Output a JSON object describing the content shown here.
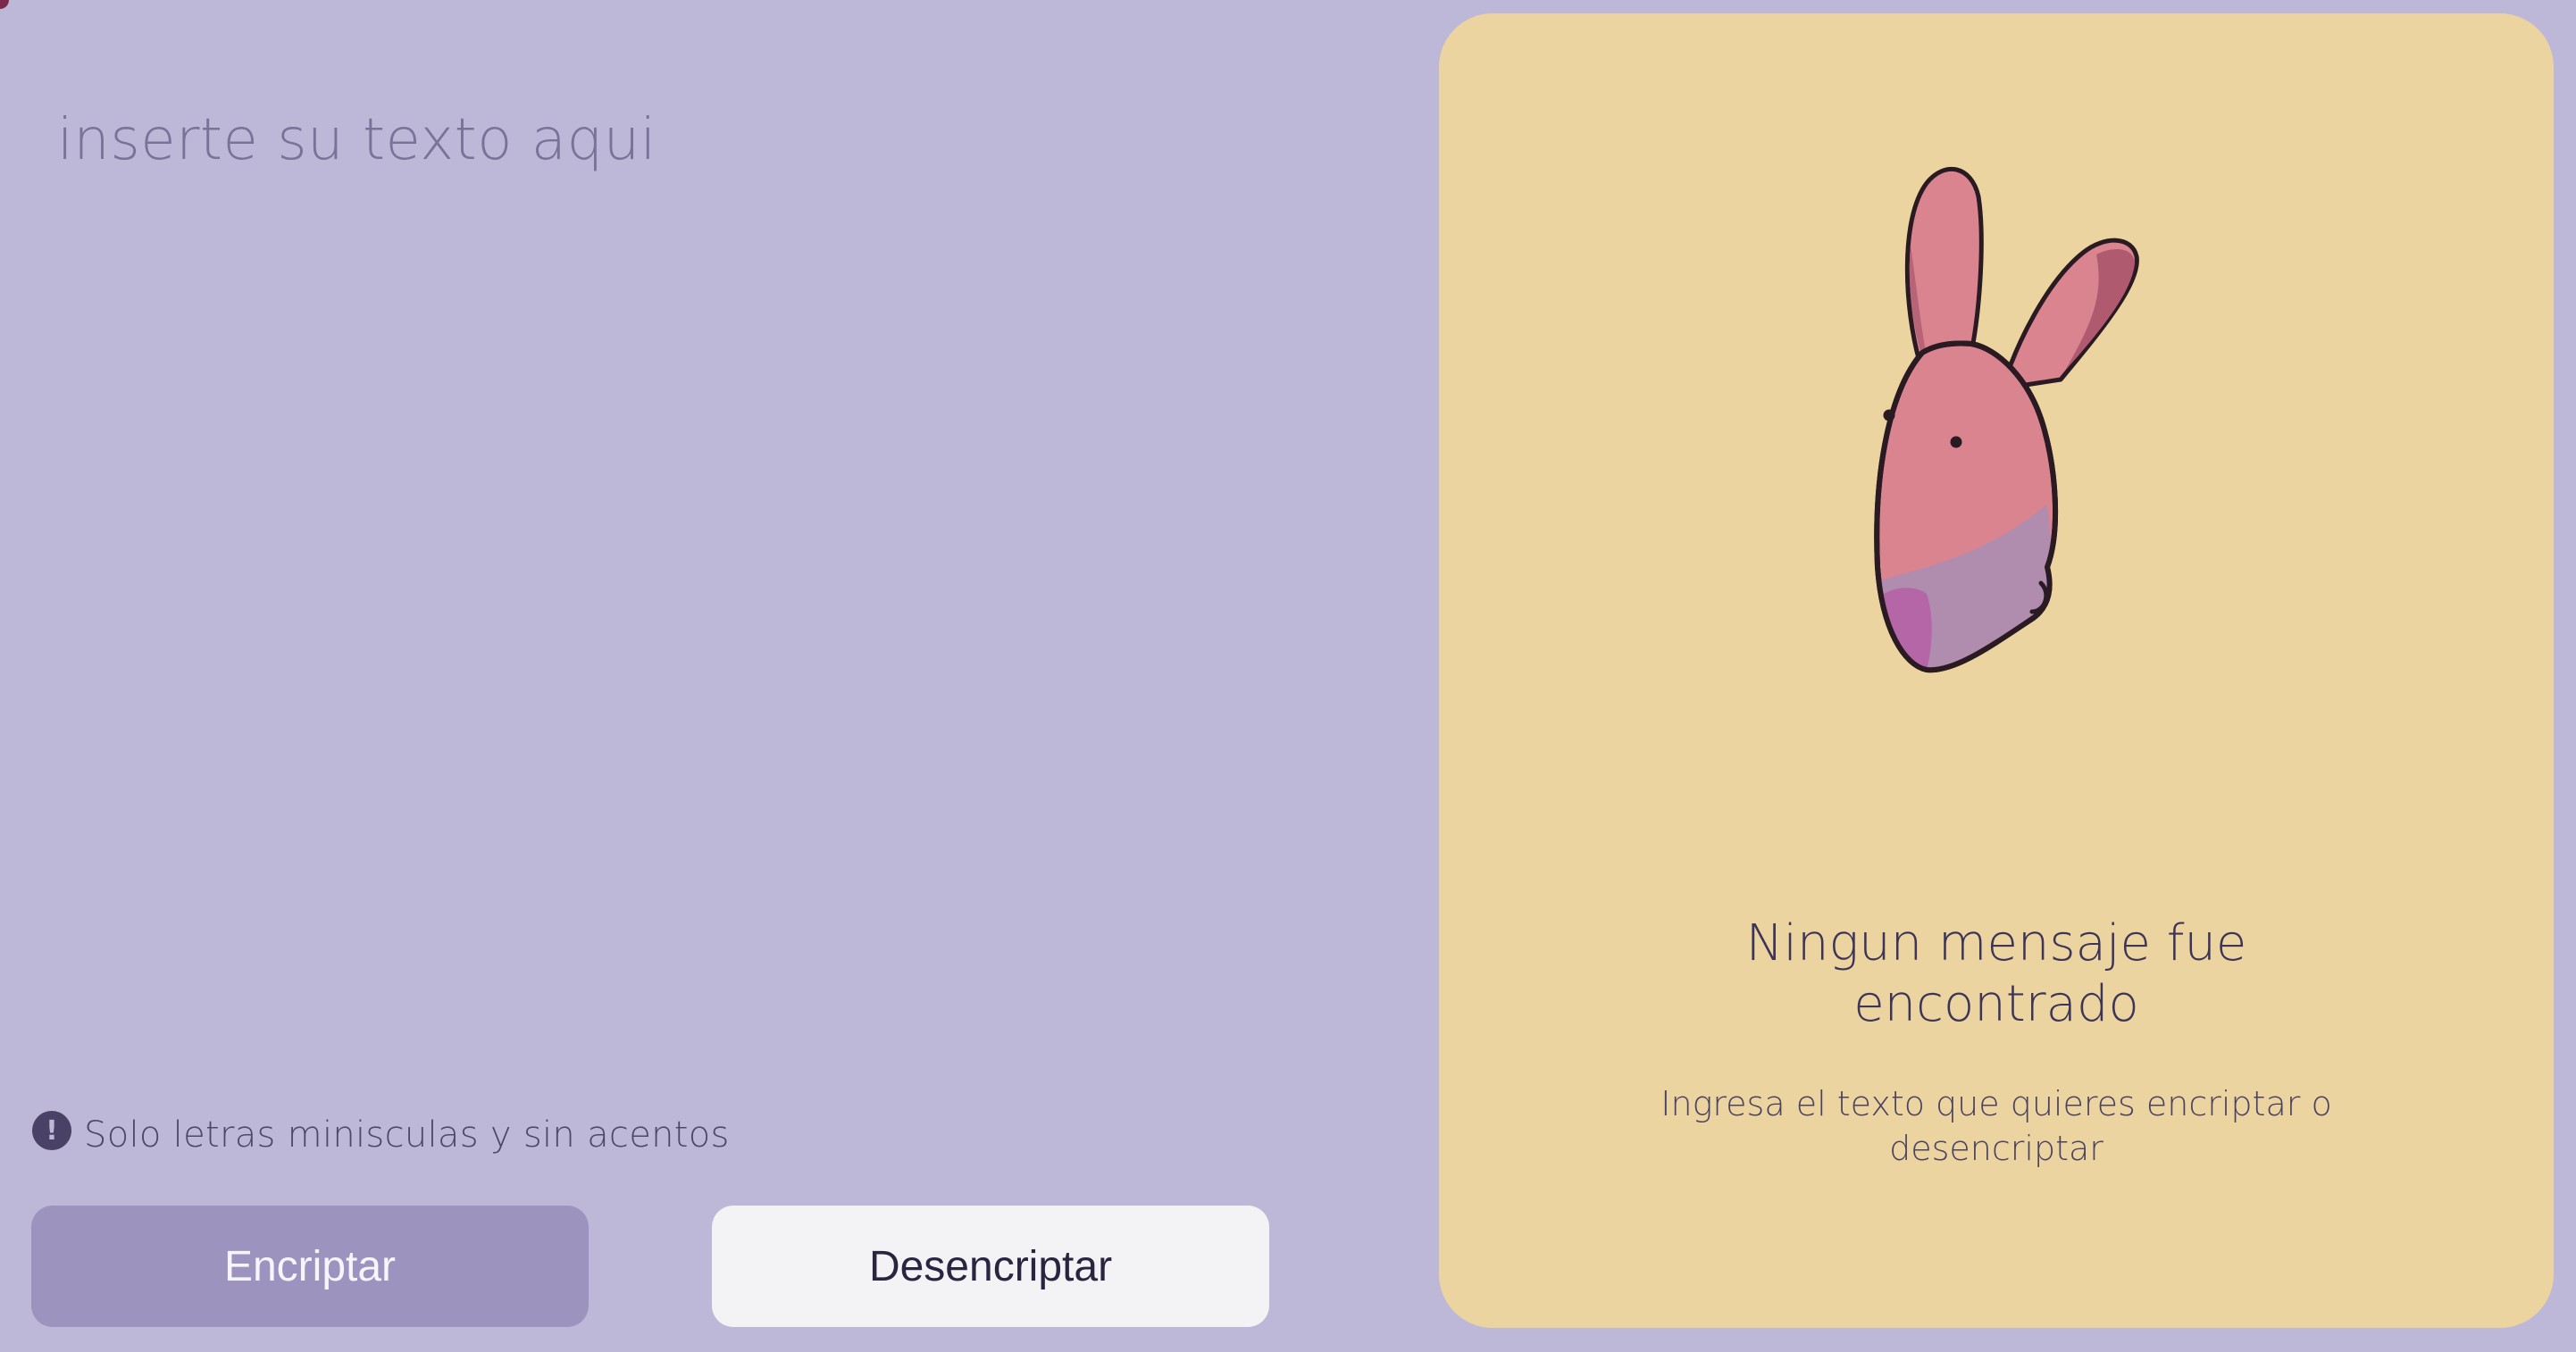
{
  "input": {
    "placeholder": "inserte su texto aqui"
  },
  "hint": {
    "icon": "exclamation-circle-icon",
    "text": "Solo letras miniscu​las y sin acentos"
  },
  "buttons": {
    "encrypt_label": "Encriptar",
    "decrypt_label": "Desencriptar"
  },
  "result_card": {
    "illustration": "bunny-illustration",
    "title_line1": "Ningun mensaje fue",
    "title_line2": "encontrado",
    "subtitle_line1": "Ingresa el texto que quieres encriptar o",
    "subtitle_line2": "desencriptar"
  },
  "colors": {
    "background": "#bdb8d7",
    "card": "#ecd4a0",
    "encrypt_button": "#9c93bf",
    "decrypt_button": "#f3f2f4",
    "text_dark": "#3d3558"
  }
}
